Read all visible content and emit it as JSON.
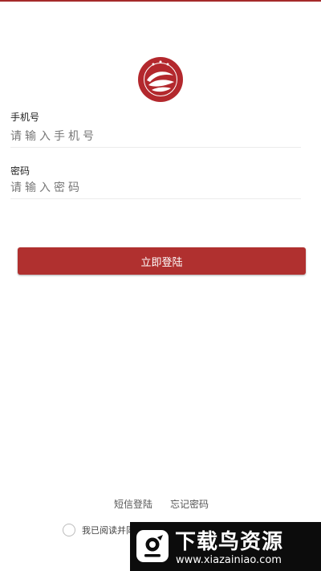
{
  "colors": {
    "accent": "#b0302f",
    "topbar": "#a52a2a",
    "divider": "#ececec"
  },
  "logo": {
    "icon": "school-emblem-icon"
  },
  "phone": {
    "label": "手机号",
    "placeholder": "请输入手机号"
  },
  "password": {
    "label": "密码",
    "placeholder": "请输入密码"
  },
  "login_button": {
    "label": "立即登陆"
  },
  "links": {
    "sms_login": "短信登陆",
    "forgot_password": "忘记密码"
  },
  "agreement": {
    "text": "我已阅读并同"
  },
  "watermark": {
    "title": "下载鸟资源",
    "url": "www.xiazainiao.com"
  }
}
